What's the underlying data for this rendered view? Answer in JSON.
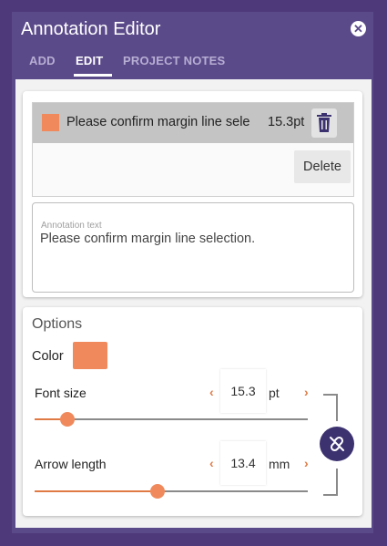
{
  "window": {
    "title": "Annotation Editor"
  },
  "tabs": [
    {
      "label": "ADD",
      "active": false
    },
    {
      "label": "EDIT",
      "active": true
    },
    {
      "label": "PROJECT NOTES",
      "active": false
    }
  ],
  "annotation_list": {
    "items": [
      {
        "color": "#f08a5d",
        "text": "Please confirm margin line sele",
        "size": "15.3pt"
      }
    ],
    "delete_tooltip": "Delete"
  },
  "annotation_text": {
    "label": "Annotation text",
    "value": "Please confirm margin line selection."
  },
  "options": {
    "title": "Options",
    "color_label": "Color",
    "color_value": "#f08a5d",
    "font_size": {
      "label": "Font size",
      "value": "15.3",
      "unit": "pt",
      "slider_fraction": 0.12
    },
    "arrow_length": {
      "label": "Arrow length",
      "value": "13.4",
      "unit": "mm",
      "slider_fraction": 0.45
    }
  },
  "colors": {
    "brand": "#5b4a8a",
    "accent": "#f08a5d",
    "link_button": "#3d3270"
  },
  "icons": {
    "close": "close-icon",
    "trash": "trash-icon",
    "link": "unlink-icon"
  }
}
